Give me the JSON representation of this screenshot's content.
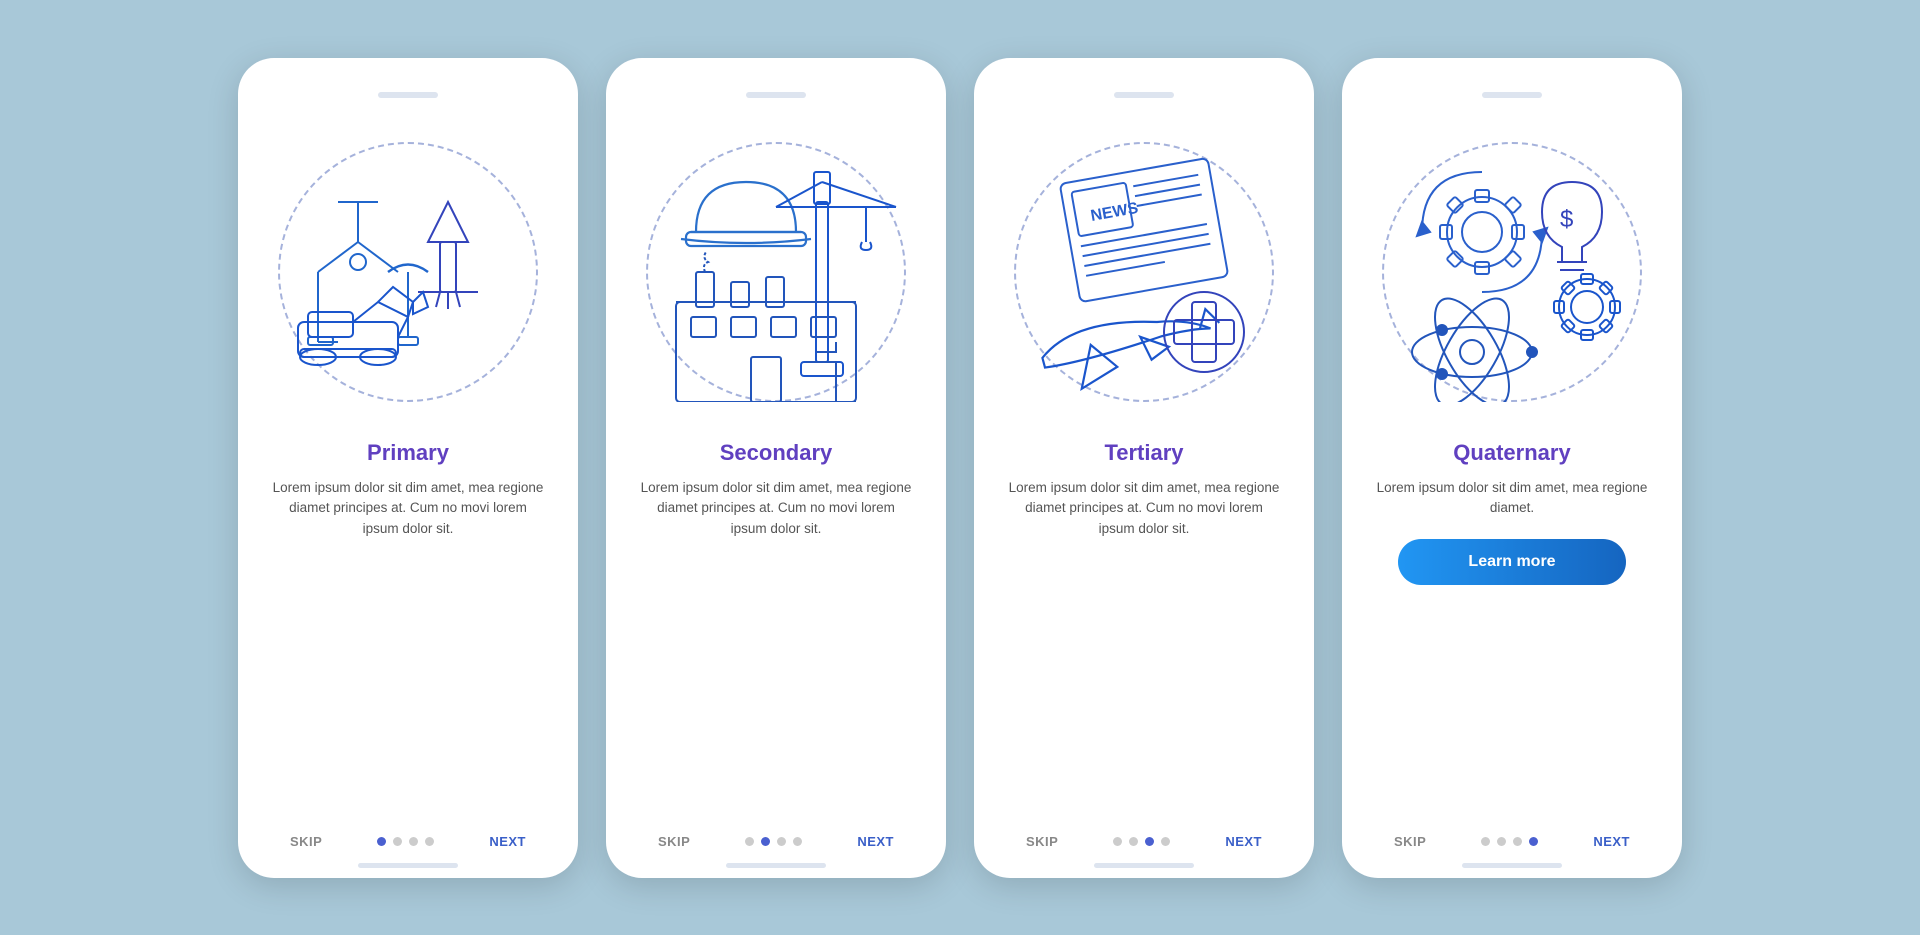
{
  "screens": [
    {
      "id": "primary",
      "title": "Primary",
      "body": "Lorem ipsum dolor sit dim amet, mea regione diamet principes at. Cum no movi lorem ipsum dolor sit.",
      "activeDot": 0,
      "hasLearnMore": false,
      "dots": [
        true,
        false,
        false,
        false
      ]
    },
    {
      "id": "secondary",
      "title": "Secondary",
      "body": "Lorem ipsum dolor sit dim amet, mea regione diamet principes at. Cum no movi lorem ipsum dolor sit.",
      "activeDot": 1,
      "hasLearnMore": false,
      "dots": [
        false,
        true,
        false,
        false
      ]
    },
    {
      "id": "tertiary",
      "title": "Tertiary",
      "body": "Lorem ipsum dolor sit dim amet, mea regione diamet principes at. Cum no movi lorem ipsum dolor sit.",
      "activeDot": 2,
      "hasLearnMore": false,
      "dots": [
        false,
        false,
        true,
        false
      ]
    },
    {
      "id": "quaternary",
      "title": "Quaternary",
      "body": "Lorem ipsum dolor sit dim amet, mea regione diamet.",
      "activeDot": 3,
      "hasLearnMore": true,
      "learnMoreLabel": "Learn more",
      "dots": [
        false,
        false,
        false,
        true
      ]
    }
  ],
  "nav": {
    "skip": "SKIP",
    "next": "NEXT"
  }
}
